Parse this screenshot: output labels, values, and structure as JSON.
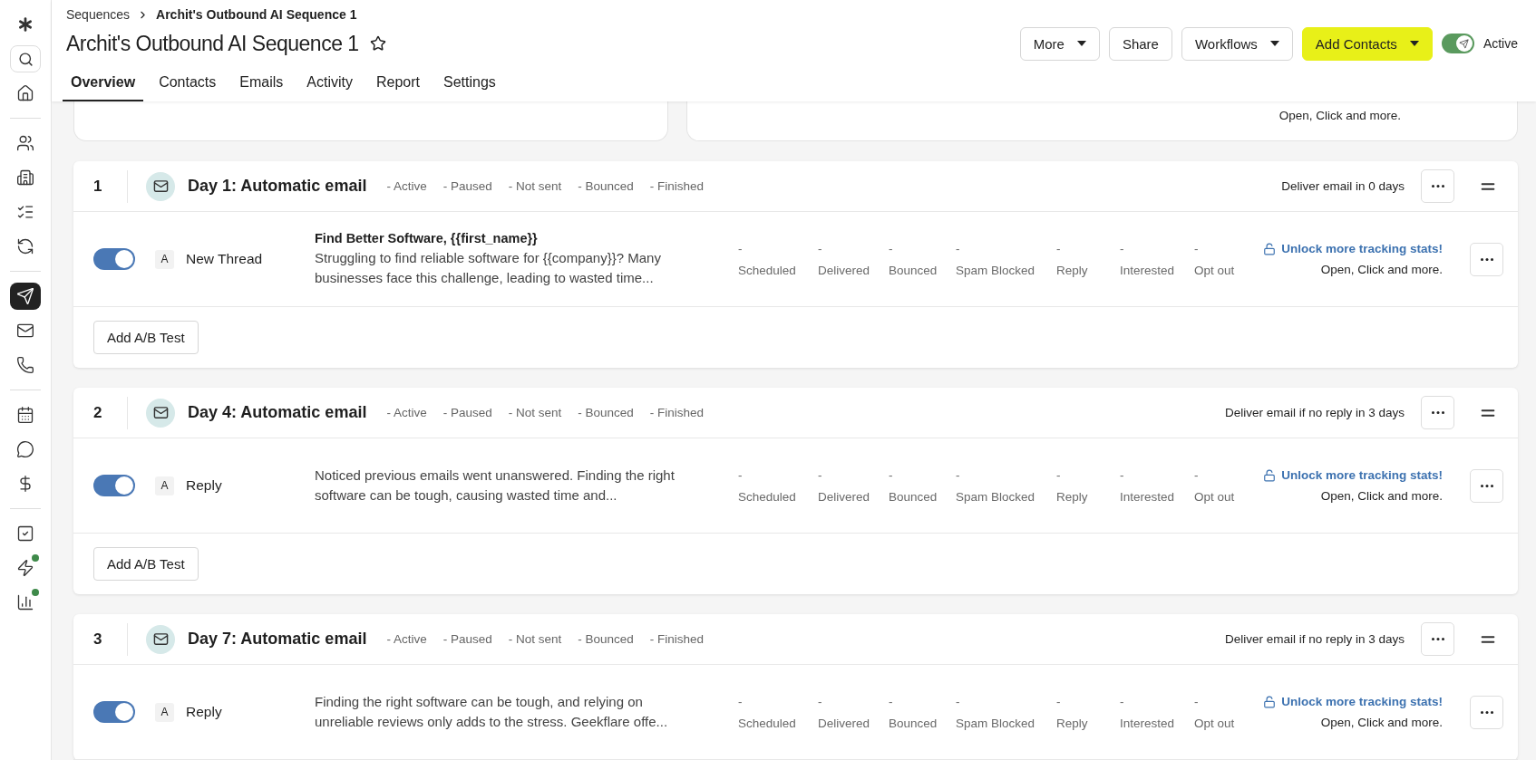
{
  "breadcrumb": {
    "parent": "Sequences",
    "current": "Archit's Outbound AI Sequence 1"
  },
  "title": "Archit's Outbound AI Sequence 1",
  "tabs": [
    {
      "label": "Overview",
      "selected": true
    },
    {
      "label": "Contacts",
      "selected": false
    },
    {
      "label": "Emails",
      "selected": false
    },
    {
      "label": "Activity",
      "selected": false
    },
    {
      "label": "Report",
      "selected": false
    },
    {
      "label": "Settings",
      "selected": false
    }
  ],
  "actions": [
    {
      "label": "More",
      "kind": "dropdown"
    },
    {
      "label": "Share",
      "kind": "plain"
    },
    {
      "label": "Workflows",
      "kind": "dropdown"
    },
    {
      "label": "Add Contacts",
      "kind": "primary"
    }
  ],
  "status_toggle": {
    "on": true,
    "label": "Active"
  },
  "summary_note": "Open, Click and more.",
  "steps": [
    {
      "number": "1",
      "title": "Day 1: Automatic email",
      "statuses": [
        "- Active",
        "- Paused",
        "- Not sent",
        "- Bounced",
        "- Finished"
      ],
      "delivery": "Deliver email in 0 days",
      "ab_button": "Add A/B Test",
      "variants": [
        {
          "on": true,
          "letter": "A",
          "type": "New Thread",
          "subject": "Find Better Software, {{first_name}}",
          "preview": "Struggling to find reliable software for {{company}}? Many businesses face this challenge, leading to wasted time...",
          "stats": [
            {
              "value": "-",
              "label": "Scheduled"
            },
            {
              "value": "-",
              "label": "Delivered"
            },
            {
              "value": "-",
              "label": "Bounced"
            },
            {
              "value": "-",
              "label": "Spam Blocked"
            },
            {
              "value": "-",
              "label": "Reply"
            },
            {
              "value": "-",
              "label": "Interested"
            },
            {
              "value": "-",
              "label": "Opt out"
            }
          ],
          "unlock": "Unlock more tracking stats!",
          "unlock_note": "Open, Click and more."
        }
      ]
    },
    {
      "number": "2",
      "title": "Day 4: Automatic email",
      "statuses": [
        "- Active",
        "- Paused",
        "- Not sent",
        "- Bounced",
        "- Finished"
      ],
      "delivery": "Deliver email if no reply in 3 days",
      "ab_button": "Add A/B Test",
      "variants": [
        {
          "on": true,
          "letter": "A",
          "type": "Reply",
          "preview": "Noticed previous emails went unanswered. Finding the right software can be tough, causing wasted time and...",
          "stats": [
            {
              "value": "-",
              "label": "Scheduled"
            },
            {
              "value": "-",
              "label": "Delivered"
            },
            {
              "value": "-",
              "label": "Bounced"
            },
            {
              "value": "-",
              "label": "Spam Blocked"
            },
            {
              "value": "-",
              "label": "Reply"
            },
            {
              "value": "-",
              "label": "Interested"
            },
            {
              "value": "-",
              "label": "Opt out"
            }
          ],
          "unlock": "Unlock more tracking stats!",
          "unlock_note": "Open, Click and more."
        }
      ]
    },
    {
      "number": "3",
      "title": "Day 7: Automatic email",
      "statuses": [
        "- Active",
        "- Paused",
        "- Not sent",
        "- Bounced",
        "- Finished"
      ],
      "delivery": "Deliver email if no reply in 3 days",
      "variants": [
        {
          "on": true,
          "letter": "A",
          "type": "Reply",
          "preview": "Finding the right software can be tough, and relying on unreliable reviews only adds to the stress. Geekflare offe...",
          "stats": [
            {
              "value": "-",
              "label": "Scheduled"
            },
            {
              "value": "-",
              "label": "Delivered"
            },
            {
              "value": "-",
              "label": "Bounced"
            },
            {
              "value": "-",
              "label": "Spam Blocked"
            },
            {
              "value": "-",
              "label": "Reply"
            },
            {
              "value": "-",
              "label": "Interested"
            },
            {
              "value": "-",
              "label": "Opt out"
            }
          ],
          "unlock": "Unlock more tracking stats!",
          "unlock_note": "Open, Click and more."
        }
      ]
    }
  ]
}
